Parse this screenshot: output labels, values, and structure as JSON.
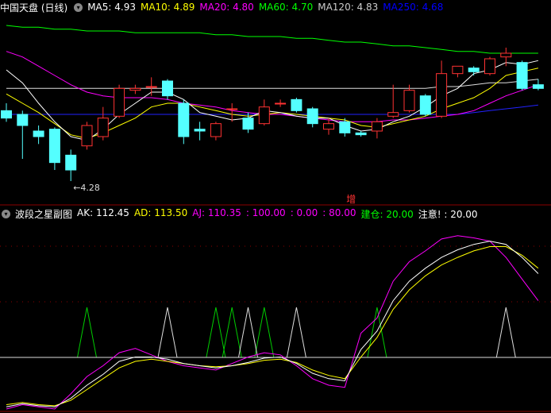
{
  "main_header": {
    "title": "中国天盘 (日线)",
    "items": [
      {
        "label": "MA5:",
        "value": "4.93",
        "color": "#ffffff"
      },
      {
        "label": "MA10:",
        "value": "4.89",
        "color": "#ffff00"
      },
      {
        "label": "MA20:",
        "value": "4.80",
        "color": "#ff00ff"
      },
      {
        "label": "MA60:",
        "value": "4.70",
        "color": "#00ff00"
      },
      {
        "label": "MA120:",
        "value": "4.83",
        "color": "#cccccc"
      },
      {
        "label": "MA250:",
        "value": "4.68",
        "color": "#0000ff"
      }
    ]
  },
  "main_chart": {
    "low_label": "4.28",
    "marker_label": "增"
  },
  "sub_header": {
    "title": "波段之星副图",
    "items": [
      {
        "label": "AK:",
        "value": "112.45",
        "color": "#ffffff"
      },
      {
        "label": "AD:",
        "value": "113.50",
        "color": "#ffff00"
      },
      {
        "label": "AJ:",
        "value": "110.35",
        "color": "#ff00ff"
      },
      {
        "label": "",
        "value": ": 100.00",
        "color": "#ff00ff"
      },
      {
        "label": "",
        "value": ": 0.00",
        "color": "#ff00ff"
      },
      {
        "label": "",
        "value": ": 80.00",
        "color": "#ff00ff"
      },
      {
        "label": "建仓:",
        "value": "20.00",
        "color": "#00ff00"
      },
      {
        "label": "注意!",
        "value": ": 20.00",
        "color": "#ffffff"
      }
    ]
  },
  "chart_data": {
    "type": "candlestick",
    "candles": [
      {
        "o": 4.66,
        "h": 4.7,
        "l": 4.6,
        "c": 4.62
      },
      {
        "o": 4.64,
        "h": 4.66,
        "l": 4.4,
        "c": 4.58
      },
      {
        "o": 4.55,
        "h": 4.58,
        "l": 4.48,
        "c": 4.52
      },
      {
        "o": 4.56,
        "h": 4.57,
        "l": 4.34,
        "c": 4.38
      },
      {
        "o": 4.42,
        "h": 4.45,
        "l": 4.28,
        "c": 4.34
      },
      {
        "o": 4.47,
        "h": 4.6,
        "l": 4.45,
        "c": 4.58
      },
      {
        "o": 4.52,
        "h": 4.68,
        "l": 4.5,
        "c": 4.62
      },
      {
        "o": 4.63,
        "h": 4.8,
        "l": 4.62,
        "c": 4.78
      },
      {
        "o": 4.77,
        "h": 4.8,
        "l": 4.75,
        "c": 4.78
      },
      {
        "o": 4.79,
        "h": 4.84,
        "l": 4.74,
        "c": 4.79
      },
      {
        "o": 4.82,
        "h": 4.83,
        "l": 4.72,
        "c": 4.74
      },
      {
        "o": 4.7,
        "h": 4.72,
        "l": 4.48,
        "c": 4.52
      },
      {
        "o": 4.56,
        "h": 4.6,
        "l": 4.5,
        "c": 4.55
      },
      {
        "o": 4.52,
        "h": 4.6,
        "l": 4.5,
        "c": 4.59
      },
      {
        "o": 4.67,
        "h": 4.7,
        "l": 4.6,
        "c": 4.67
      },
      {
        "o": 4.62,
        "h": 4.65,
        "l": 4.54,
        "c": 4.56
      },
      {
        "o": 4.59,
        "h": 4.72,
        "l": 4.58,
        "c": 4.68
      },
      {
        "o": 4.7,
        "h": 4.72,
        "l": 4.68,
        "c": 4.7
      },
      {
        "o": 4.72,
        "h": 4.73,
        "l": 4.65,
        "c": 4.66
      },
      {
        "o": 4.67,
        "h": 4.68,
        "l": 4.57,
        "c": 4.59
      },
      {
        "o": 4.56,
        "h": 4.62,
        "l": 4.53,
        "c": 4.59
      },
      {
        "o": 4.6,
        "h": 4.62,
        "l": 4.52,
        "c": 4.54
      },
      {
        "o": 4.54,
        "h": 4.55,
        "l": 4.52,
        "c": 4.53
      },
      {
        "o": 4.55,
        "h": 4.62,
        "l": 4.51,
        "c": 4.6
      },
      {
        "o": 4.63,
        "h": 4.8,
        "l": 4.62,
        "c": 4.65
      },
      {
        "o": 4.66,
        "h": 4.8,
        "l": 4.65,
        "c": 4.77
      },
      {
        "o": 4.74,
        "h": 4.75,
        "l": 4.63,
        "c": 4.64
      },
      {
        "o": 4.63,
        "h": 4.93,
        "l": 4.62,
        "c": 4.86
      },
      {
        "o": 4.86,
        "h": 4.9,
        "l": 4.84,
        "c": 4.9
      },
      {
        "o": 4.89,
        "h": 4.9,
        "l": 4.85,
        "c": 4.87
      },
      {
        "o": 4.86,
        "h": 4.95,
        "l": 4.85,
        "c": 4.94
      },
      {
        "o": 4.95,
        "h": 5.0,
        "l": 4.9,
        "c": 4.97
      },
      {
        "o": 4.92,
        "h": 4.93,
        "l": 4.77,
        "c": 4.78
      },
      {
        "o": 4.8,
        "h": 4.83,
        "l": 4.77,
        "c": 4.78
      }
    ],
    "ma": {
      "MA60": [
        5.12,
        5.11,
        5.11,
        5.1,
        5.1,
        5.09,
        5.09,
        5.09,
        5.08,
        5.08,
        5.08,
        5.08,
        5.08,
        5.07,
        5.07,
        5.06,
        5.06,
        5.06,
        5.05,
        5.05,
        5.04,
        5.03,
        5.03,
        5.02,
        5.01,
        5.01,
        5.0,
        4.99,
        4.98,
        4.98,
        4.97,
        4.97,
        4.97,
        4.97
      ],
      "MA120": [
        4.78,
        4.78,
        4.78,
        4.78,
        4.78,
        4.78,
        4.78,
        4.78,
        4.78,
        4.78,
        4.78,
        4.78,
        4.78,
        4.78,
        4.78,
        4.78,
        4.78,
        4.78,
        4.78,
        4.78,
        4.78,
        4.78,
        4.78,
        4.78,
        4.78,
        4.78,
        4.78,
        4.79,
        4.79,
        4.8,
        4.81,
        4.81,
        4.82,
        4.83
      ],
      "MA250": [
        4.64,
        4.64,
        4.64,
        4.64,
        4.64,
        4.64,
        4.64,
        4.64,
        4.64,
        4.64,
        4.64,
        4.64,
        4.64,
        4.64,
        4.64,
        4.64,
        4.64,
        4.64,
        4.64,
        4.64,
        4.64,
        4.64,
        4.64,
        4.64,
        4.64,
        4.64,
        4.64,
        4.64,
        4.64,
        4.65,
        4.66,
        4.67,
        4.68,
        4.69
      ],
      "MA20": [
        4.98,
        4.95,
        4.9,
        4.85,
        4.8,
        4.76,
        4.74,
        4.73,
        4.73,
        4.73,
        4.72,
        4.7,
        4.69,
        4.68,
        4.66,
        4.65,
        4.64,
        4.64,
        4.63,
        4.62,
        4.61,
        4.6,
        4.6,
        4.6,
        4.61,
        4.61,
        4.62,
        4.63,
        4.64,
        4.66,
        4.7,
        4.74,
        4.77,
        4.8
      ],
      "MA10": [
        4.75,
        4.7,
        4.65,
        4.59,
        4.53,
        4.51,
        4.54,
        4.58,
        4.62,
        4.68,
        4.7,
        4.7,
        4.68,
        4.66,
        4.64,
        4.63,
        4.64,
        4.65,
        4.64,
        4.63,
        4.62,
        4.61,
        4.58,
        4.57,
        4.59,
        4.61,
        4.63,
        4.67,
        4.7,
        4.73,
        4.78,
        4.85,
        4.87,
        4.89
      ],
      "MA5": [
        4.88,
        4.81,
        4.7,
        4.6,
        4.52,
        4.5,
        4.56,
        4.64,
        4.7,
        4.76,
        4.76,
        4.72,
        4.65,
        4.63,
        4.61,
        4.62,
        4.66,
        4.65,
        4.63,
        4.62,
        4.62,
        4.58,
        4.55,
        4.56,
        4.6,
        4.63,
        4.68,
        4.74,
        4.78,
        4.86,
        4.88,
        4.92,
        4.91,
        4.93
      ]
    },
    "sub": {
      "AK": [
        2,
        5,
        3,
        2,
        10,
        22,
        32,
        44,
        48,
        48,
        46,
        42,
        40,
        38,
        40,
        43,
        47,
        48,
        42,
        33,
        28,
        26,
        55,
        72,
        100,
        118,
        130,
        140,
        147,
        152,
        155,
        152,
        140,
        125
      ],
      "AD": [
        4,
        6,
        4,
        3,
        8,
        18,
        28,
        38,
        44,
        46,
        44,
        42,
        40,
        39,
        40,
        42,
        45,
        46,
        43,
        36,
        31,
        28,
        48,
        66,
        92,
        110,
        123,
        133,
        140,
        146,
        150,
        150,
        142,
        130
      ],
      "AJ": [
        0,
        4,
        2,
        0,
        14,
        30,
        40,
        52,
        56,
        50,
        44,
        40,
        38,
        36,
        42,
        48,
        52,
        50,
        40,
        28,
        22,
        20,
        70,
        84,
        118,
        136,
        146,
        157,
        160,
        158,
        155,
        140,
        120,
        100
      ],
      "triangles_green": [
        5,
        13,
        14,
        16,
        23
      ],
      "triangles_white": [
        10,
        15,
        18,
        31
      ]
    }
  }
}
